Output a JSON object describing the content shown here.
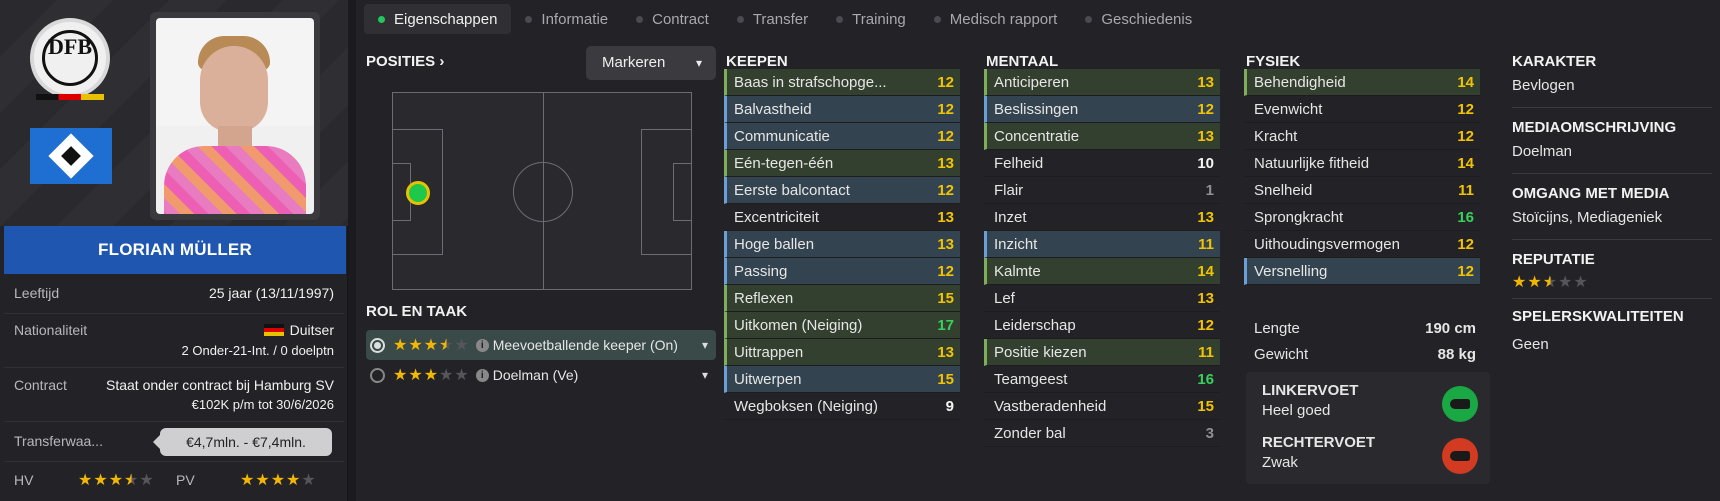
{
  "profile": {
    "name": "FLORIAN MÜLLER",
    "age_label": "Leeftijd",
    "age_value": "25 jaar (13/11/1997)",
    "nationality_label": "Nationaliteit",
    "nationality_value": "Duitser",
    "nationality_caps": "2 Onder-21-Int. / 0 doelptn",
    "contract_label": "Contract",
    "contract_line1": "Staat onder contract bij Hamburg SV",
    "contract_line2": "€102K p/m tot 30/6/2026",
    "transfer_label": "Transferwaa...",
    "transfer_value": "€4,7mln. - €7,4mln.",
    "ca_label": "HV",
    "pa_label": "PV",
    "ca_stars": 3.5,
    "pa_stars": 4,
    "national_crest_text": "DFB"
  },
  "tabs": [
    {
      "label": "Eigenschappen",
      "active": true
    },
    {
      "label": "Informatie",
      "active": false
    },
    {
      "label": "Contract",
      "active": false
    },
    {
      "label": "Transfer",
      "active": false
    },
    {
      "label": "Training",
      "active": false
    },
    {
      "label": "Medisch rapport",
      "active": false
    },
    {
      "label": "Geschiedenis",
      "active": false
    }
  ],
  "positions": {
    "title": "POSITIES",
    "markeren_label": "Markeren"
  },
  "roles": {
    "title": "ROL EN TAAK",
    "items": [
      {
        "label": "Meevoetballende keeper (On)",
        "stars": 3.5,
        "selected": true
      },
      {
        "label": "Doelman (Ve)",
        "stars": 3,
        "selected": false
      }
    ]
  },
  "keepen": {
    "title": "KEEPEN",
    "items": [
      {
        "name": "Baas in strafschopge...",
        "value": "12",
        "hl": "g",
        "color": "yellow"
      },
      {
        "name": "Balvastheid",
        "value": "12",
        "hl": "b",
        "color": "yellow"
      },
      {
        "name": "Communicatie",
        "value": "12",
        "hl": "b",
        "color": "yellow"
      },
      {
        "name": "Eén-tegen-één",
        "value": "13",
        "hl": "g",
        "color": "yellow"
      },
      {
        "name": "Eerste balcontact",
        "value": "12",
        "hl": "b",
        "color": "yellow"
      },
      {
        "name": "Excentriciteit",
        "value": "13",
        "hl": "",
        "color": "yellow"
      },
      {
        "name": "Hoge ballen",
        "value": "13",
        "hl": "b",
        "color": "yellow"
      },
      {
        "name": "Passing",
        "value": "12",
        "hl": "b",
        "color": "yellow"
      },
      {
        "name": "Reflexen",
        "value": "15",
        "hl": "g",
        "color": "yellow"
      },
      {
        "name": "Uitkomen (Neiging)",
        "value": "17",
        "hl": "g",
        "color": "green"
      },
      {
        "name": "Uittrappen",
        "value": "13",
        "hl": "g",
        "color": "yellow"
      },
      {
        "name": "Uitwerpen",
        "value": "15",
        "hl": "b",
        "color": "yellow"
      },
      {
        "name": "Wegboksen (Neiging)",
        "value": "9",
        "hl": "",
        "color": "white"
      }
    ]
  },
  "mentaal": {
    "title": "MENTAAL",
    "items": [
      {
        "name": "Anticiperen",
        "value": "13",
        "hl": "g",
        "color": "yellow"
      },
      {
        "name": "Beslissingen",
        "value": "12",
        "hl": "b",
        "color": "yellow"
      },
      {
        "name": "Concentratie",
        "value": "13",
        "hl": "g",
        "color": "yellow"
      },
      {
        "name": "Felheid",
        "value": "10",
        "hl": "",
        "color": "white"
      },
      {
        "name": "Flair",
        "value": "1",
        "hl": "",
        "color": "grey"
      },
      {
        "name": "Inzet",
        "value": "13",
        "hl": "",
        "color": "yellow"
      },
      {
        "name": "Inzicht",
        "value": "11",
        "hl": "b",
        "color": "yellow"
      },
      {
        "name": "Kalmte",
        "value": "14",
        "hl": "g",
        "color": "yellow"
      },
      {
        "name": "Lef",
        "value": "13",
        "hl": "",
        "color": "yellow"
      },
      {
        "name": "Leiderschap",
        "value": "12",
        "hl": "",
        "color": "yellow"
      },
      {
        "name": "Positie kiezen",
        "value": "11",
        "hl": "g",
        "color": "yellow"
      },
      {
        "name": "Teamgeest",
        "value": "16",
        "hl": "",
        "color": "green"
      },
      {
        "name": "Vastberadenheid",
        "value": "15",
        "hl": "",
        "color": "yellow"
      },
      {
        "name": "Zonder bal",
        "value": "3",
        "hl": "",
        "color": "grey"
      }
    ]
  },
  "fysiek": {
    "title": "FYSIEK",
    "items": [
      {
        "name": "Behendigheid",
        "value": "14",
        "hl": "g",
        "color": "yellow"
      },
      {
        "name": "Evenwicht",
        "value": "12",
        "hl": "",
        "color": "yellow"
      },
      {
        "name": "Kracht",
        "value": "12",
        "hl": "",
        "color": "yellow"
      },
      {
        "name": "Natuurlijke fitheid",
        "value": "14",
        "hl": "",
        "color": "yellow"
      },
      {
        "name": "Snelheid",
        "value": "11",
        "hl": "",
        "color": "yellow"
      },
      {
        "name": "Sprongkracht",
        "value": "16",
        "hl": "",
        "color": "green"
      },
      {
        "name": "Uithoudingsvermogen",
        "value": "12",
        "hl": "",
        "color": "yellow"
      },
      {
        "name": "Versnelling",
        "value": "12",
        "hl": "b",
        "color": "yellow"
      }
    ],
    "length_label": "Lengte",
    "length_value": "190 cm",
    "weight_label": "Gewicht",
    "weight_value": "88 kg",
    "left_foot_label": "LINKERVOET",
    "left_foot_value": "Heel goed",
    "right_foot_label": "RECHTERVOET",
    "right_foot_value": "Zwak"
  },
  "karakter": {
    "title": "KARAKTER",
    "value": "Bevlogen",
    "media_desc_title": "MEDIAOMSCHRIJVING",
    "media_desc_value": "Doelman",
    "media_handling_title": "OMGANG MET MEDIA",
    "media_handling_value": "Stoïcijns, Mediageniek",
    "reputation_title": "REPUTATIE",
    "reputation_stars": 2.5,
    "qualities_title": "SPELERSKWALITEITEN",
    "qualities_value": "Geen"
  },
  "colors": {
    "accent_green": "#22c55e",
    "value_yellow": "#f2c300",
    "value_green": "#37d05b",
    "name_bar": "#1f56b0",
    "foot_good": "#1aa845",
    "foot_weak": "#d23a22"
  }
}
